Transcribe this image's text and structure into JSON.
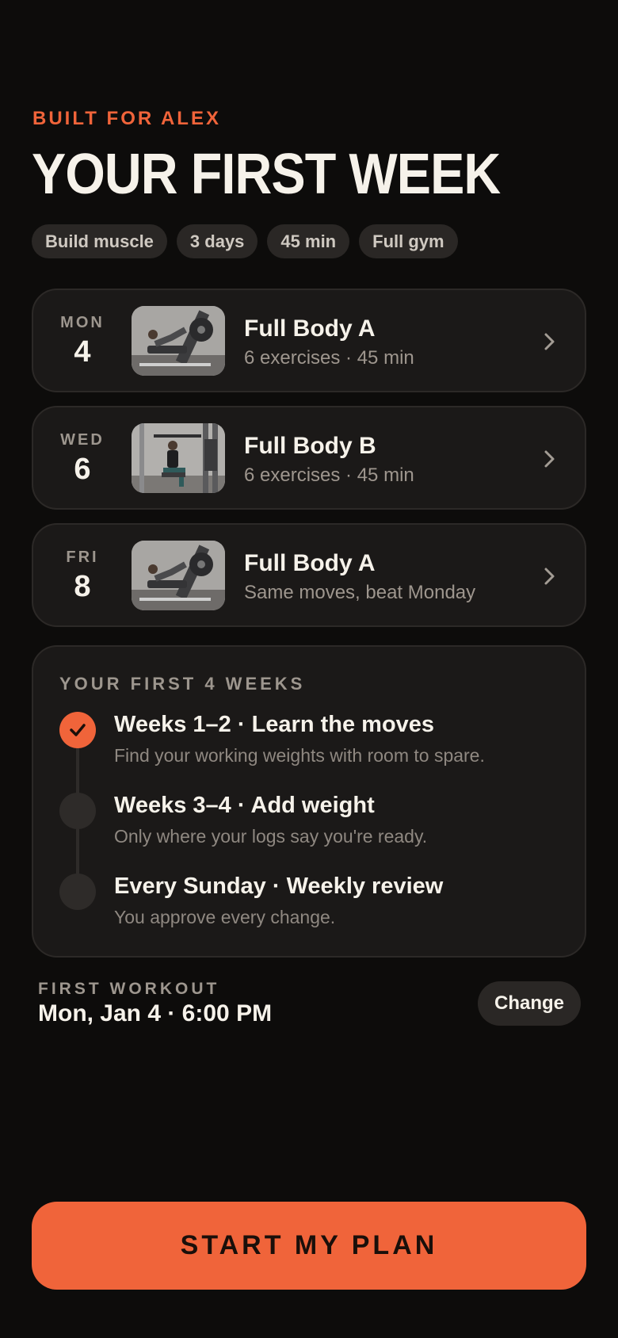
{
  "header": {
    "eyebrow": "BUILT FOR ALEX",
    "title": "YOUR FIRST WEEK",
    "chips": [
      "Build muscle",
      "3 days",
      "45 min",
      "Full gym"
    ]
  },
  "workouts": [
    {
      "dow": "MON",
      "day": "4",
      "title": "Full Body A",
      "subtitle": "6 exercises · 45 min",
      "image": "leg-press-photo"
    },
    {
      "dow": "WED",
      "day": "6",
      "title": "Full Body B",
      "subtitle": "6 exercises · 45 min",
      "image": "lat-pulldown-photo"
    },
    {
      "dow": "FRI",
      "day": "8",
      "title": "Full Body A",
      "subtitle": "Same moves, beat Monday",
      "image": "leg-press-photo"
    }
  ],
  "plan": {
    "eyebrow": "YOUR FIRST 4 WEEKS",
    "steps": [
      {
        "title": "Weeks 1–2 · Learn the moves",
        "subtitle": "Find your working weights with room to spare.",
        "status": "done"
      },
      {
        "title": "Weeks 3–4 · Add weight",
        "subtitle": "Only where your logs say you're ready.",
        "status": "upcoming"
      },
      {
        "title": "Every Sunday · Weekly review",
        "subtitle": "You approve every change.",
        "status": "upcoming"
      }
    ]
  },
  "first_workout": {
    "label": "FIRST WORKOUT",
    "value": "Mon, Jan 4 · 6:00 PM",
    "change_label": "Change"
  },
  "cta": {
    "label": "START MY PLAN"
  },
  "colors": {
    "accent": "#f0643a",
    "background": "#0d0c0b",
    "card": "#1b1918",
    "chip": "#2a2725"
  },
  "icons": {
    "chevron": "chevron-right-icon",
    "check": "check-icon"
  }
}
